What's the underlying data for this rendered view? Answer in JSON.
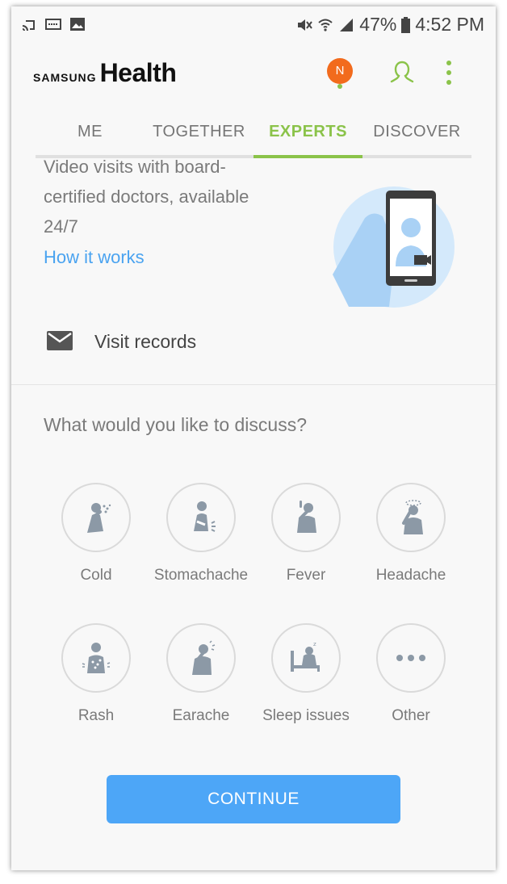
{
  "status_bar": {
    "battery": "47%",
    "time": "4:52 PM",
    "left_icons": [
      "cast-icon",
      "voicemail-icon",
      "image-icon"
    ],
    "right_icons": [
      "mute-icon",
      "wifi-icon",
      "signal-icon",
      "battery-icon"
    ]
  },
  "header": {
    "brand": "SAMSUNG",
    "app_name": "Health",
    "avatar_initial": "N",
    "avatar_color": "#f26b1d",
    "accent_color": "#8bc34a"
  },
  "tabs": [
    {
      "label": "ME"
    },
    {
      "label": "TOGETHER"
    },
    {
      "label": "EXPERTS",
      "active": true
    },
    {
      "label": "DISCOVER"
    }
  ],
  "experts": {
    "intro_text": "Video visits with board-certified doctors, available 24/7",
    "how_link": "How it works",
    "visit_records": "Visit records",
    "question": "What would you like to discuss?",
    "topics": [
      {
        "label": "Cold",
        "icon": "cold-icon"
      },
      {
        "label": "Stomachache",
        "icon": "stomachache-icon"
      },
      {
        "label": "Fever",
        "icon": "fever-icon"
      },
      {
        "label": "Headache",
        "icon": "headache-icon"
      },
      {
        "label": "Rash",
        "icon": "rash-icon"
      },
      {
        "label": "Earache",
        "icon": "earache-icon"
      },
      {
        "label": "Sleep issues",
        "icon": "sleep-issues-icon"
      },
      {
        "label": "Other",
        "icon": "more-horizontal-icon"
      }
    ],
    "continue_label": "CONTINUE",
    "button_color": "#4da6f7"
  }
}
